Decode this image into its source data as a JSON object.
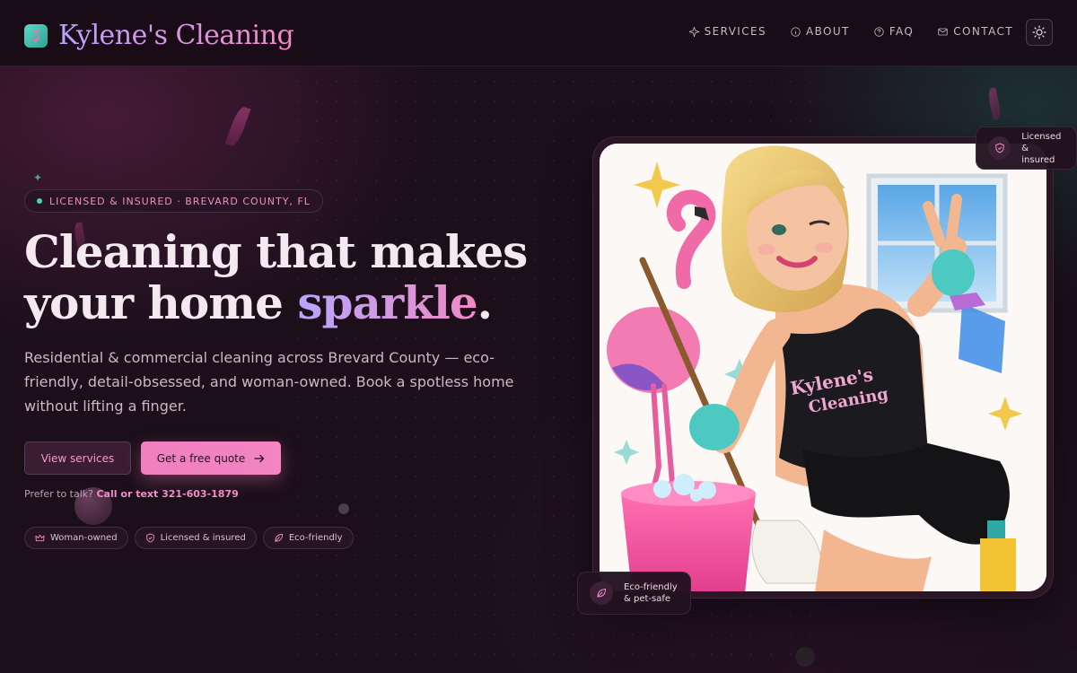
{
  "brand": {
    "name": "Kylene's Cleaning",
    "logo_icon": "flamingo-icon"
  },
  "nav": {
    "items": [
      {
        "label": "SERVICES",
        "icon": "sparkle-icon"
      },
      {
        "label": "ABOUT",
        "icon": "info-icon"
      },
      {
        "label": "FAQ",
        "icon": "question-icon"
      },
      {
        "label": "CONTACT",
        "icon": "mail-icon"
      }
    ],
    "theme_toggle_icon": "sun-icon"
  },
  "hero": {
    "badge": "LICENSED & INSURED · BREVARD COUNTY, FL",
    "headline": {
      "line1": "Cleaning that makes",
      "line2_prefix": "your home ",
      "accent": "sparkle",
      "suffix": "."
    },
    "lede": "Residential & commercial cleaning across Brevard County — eco-friendly, detail-obsessed, and woman-owned. Book a spotless home without lifting a finger.",
    "buttons": {
      "secondary": "View services",
      "primary": "Get a free quote",
      "primary_icon": "arrow-right-icon"
    },
    "call": {
      "prefix": "Prefer to talk?",
      "link": "Call or text 321-603-1879"
    },
    "chips": [
      {
        "label": "Woman-owned",
        "icon": "crown-icon"
      },
      {
        "label": "Licensed & insured",
        "icon": "shield-icon"
      },
      {
        "label": "Eco-friendly",
        "icon": "leaf-icon"
      }
    ]
  },
  "image": {
    "shirt_line1": "Kylene's",
    "shirt_line2": "Cleaning"
  },
  "floating_badges": {
    "top": {
      "line1": "Licensed",
      "line2": "& insured",
      "icon": "shield-icon"
    },
    "bottom": {
      "line1": "Eco-friendly",
      "line2": "& pet-safe",
      "icon": "leaf-icon"
    }
  },
  "colors": {
    "accent_pink": "#f07fc0",
    "accent_lavender": "#b7a6ff",
    "teal": "#4fd1b7",
    "background": "#1c0f1a"
  }
}
